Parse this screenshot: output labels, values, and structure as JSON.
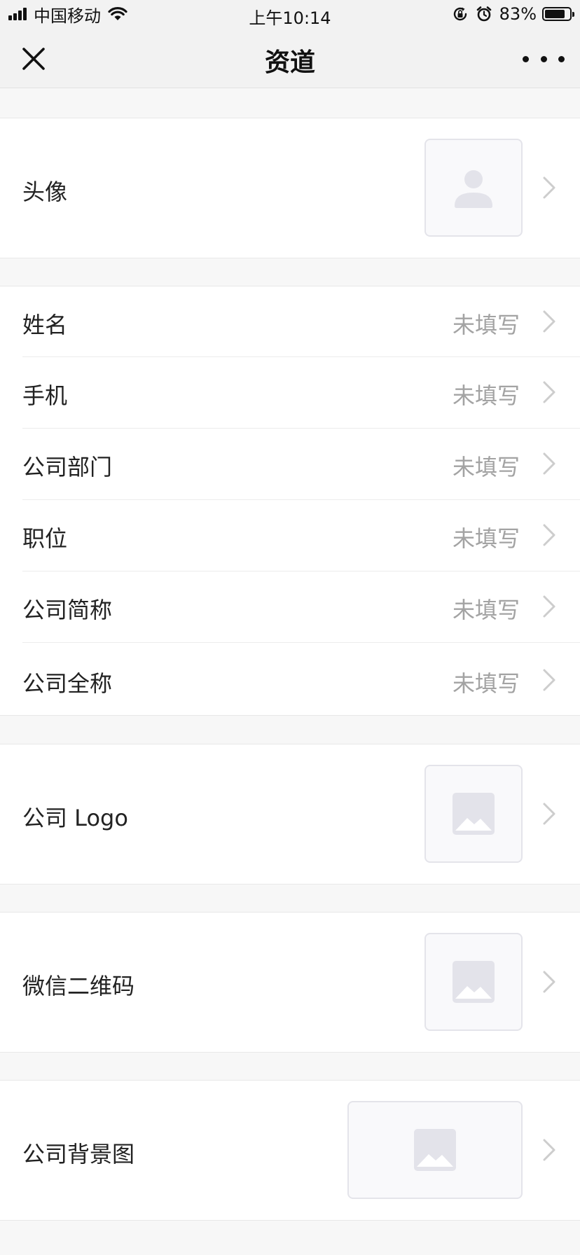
{
  "status_bar": {
    "carrier": "中国移动",
    "time": "上午10:14",
    "battery": "83%",
    "battery_level": 0.83,
    "icons": [
      "signal-icon",
      "wifi-icon",
      "rotation-lock-icon",
      "alarm-icon",
      "battery-icon"
    ]
  },
  "nav": {
    "title": "资道",
    "close_icon": "close-icon",
    "more_icon": "more-icon"
  },
  "profile": {
    "avatar_label": "头像",
    "avatar_icon": "user-placeholder-icon",
    "fields": [
      {
        "label": "姓名",
        "value": "未填写"
      },
      {
        "label": "手机",
        "value": "未填写"
      },
      {
        "label": "公司部门",
        "value": "未填写"
      },
      {
        "label": "职位",
        "value": "未填写"
      },
      {
        "label": "公司简称",
        "value": "未填写"
      },
      {
        "label": "公司全称",
        "value": "未填写"
      }
    ],
    "logo_label": "公司 Logo",
    "qrcode_label": "微信二维码",
    "background_label": "公司背景图",
    "image_icon": "image-placeholder-icon",
    "chevron_icon": "chevron-right-icon"
  },
  "colors": {
    "background": "#f7f7f7",
    "bar": "#f2f2f2",
    "placeholder": "#e3e3ea",
    "muted_text": "#a3a3a3"
  }
}
